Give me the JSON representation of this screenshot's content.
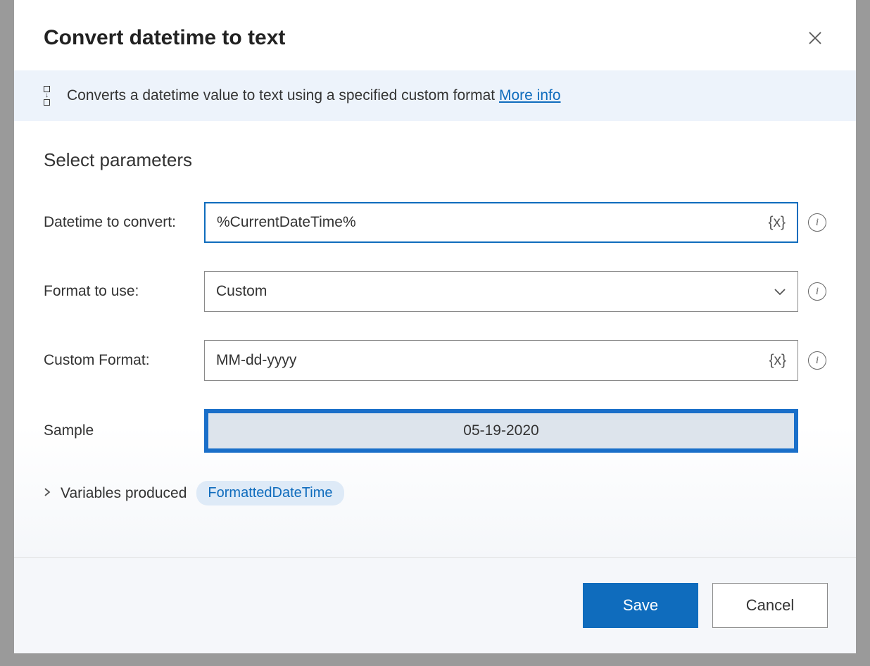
{
  "dialog": {
    "title": "Convert datetime to text",
    "description": "Converts a datetime value to text using a specified custom format",
    "more_info_label": "More info"
  },
  "section": {
    "title": "Select parameters"
  },
  "fields": {
    "datetime_label": "Datetime to convert:",
    "datetime_value": "%CurrentDateTime%",
    "variable_token": "{x}",
    "format_label": "Format to use:",
    "format_value": "Custom",
    "custom_format_label": "Custom Format:",
    "custom_format_value": "MM-dd-yyyy",
    "sample_label": "Sample",
    "sample_value": "05-19-2020"
  },
  "variables": {
    "label": "Variables produced",
    "output": "FormattedDateTime"
  },
  "buttons": {
    "save": "Save",
    "cancel": "Cancel"
  }
}
